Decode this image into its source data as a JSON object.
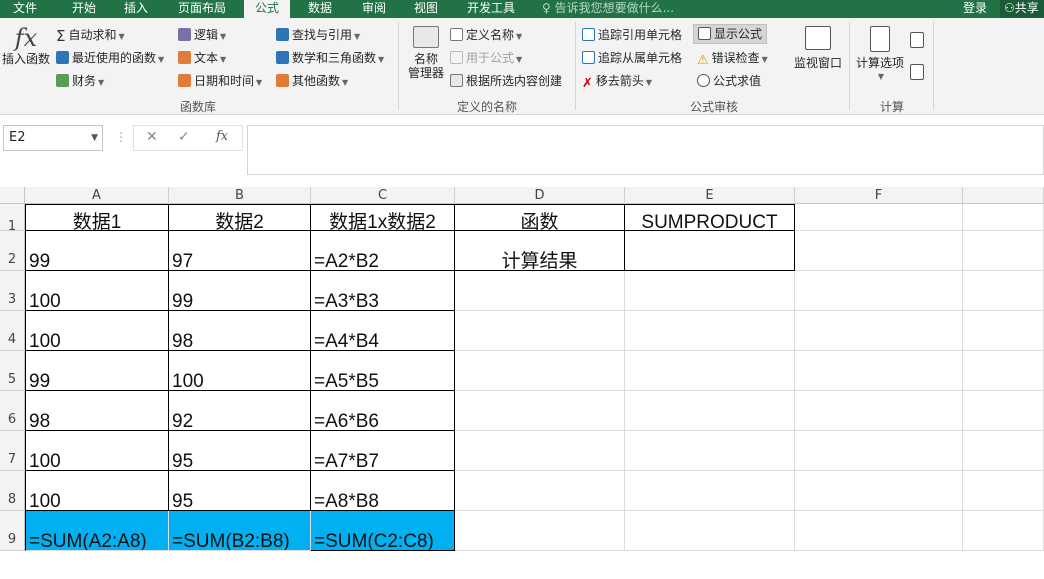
{
  "tabs": [
    "文件",
    "开始",
    "插入",
    "页面布局",
    "公式",
    "数据",
    "审阅",
    "视图",
    "开发工具"
  ],
  "active_tab": "公式",
  "tell_me": "告诉我您想要做什么...",
  "login": "登录",
  "share": "共享",
  "ribbon": {
    "insert_function": "插入函数",
    "autosum": "自动求和",
    "recent": "最近使用的函数",
    "finance": "财务",
    "logic": "逻辑",
    "text": "文本",
    "datetime": "日期和时间",
    "lookup": "查找与引用",
    "math": "数学和三角函数",
    "other": "其他函数",
    "group_library": "函数库",
    "name_manager_1": "名称",
    "name_manager_2": "管理器",
    "define_name": "定义名称",
    "use_in_formula": "用于公式",
    "create_from_selection": "根据所选内容创建",
    "group_defined_names": "定义的名称",
    "trace_precedents": "追踪引用单元格",
    "trace_dependents": "追踪从属单元格",
    "remove_arrows": "移去箭头",
    "show_formulas": "显示公式",
    "error_checking": "错误检查",
    "evaluate_formula": "公式求值",
    "watch_window": "监视窗口",
    "group_formula_auditing": "公式审核",
    "calc_options": "计算选项",
    "group_calculation": "计算"
  },
  "namebox": "E2",
  "fx": "fx",
  "columns": [
    "A",
    "B",
    "C",
    "D",
    "E",
    "F"
  ],
  "rows": [
    "1",
    "2",
    "3",
    "4",
    "5",
    "6",
    "7",
    "8",
    "9"
  ],
  "cells": {
    "A1": "数据1",
    "B1": "数据2",
    "C1": "数据1x数据2",
    "D1": "函数",
    "E1": "SUMPRODUCT",
    "A2": "99",
    "B2": "97",
    "C2": "=A2*B2",
    "D2": "计算结果",
    "A3": "100",
    "B3": "99",
    "C3": "=A3*B3",
    "A4": "100",
    "B4": "98",
    "C4": "=A4*B4",
    "A5": "99",
    "B5": "100",
    "C5": "=A5*B5",
    "A6": "98",
    "B6": "92",
    "C6": "=A6*B6",
    "A7": "100",
    "B7": "95",
    "C7": "=A7*B7",
    "A8": "100",
    "B8": "95",
    "C8": "=A8*B8",
    "A9": "=SUM(A2:A8)",
    "B9": "=SUM(B2:B8)",
    "C9": "=SUM(C2:C8)"
  },
  "colors": {
    "excel_green": "#217346",
    "highlight": "#00b0f0"
  }
}
